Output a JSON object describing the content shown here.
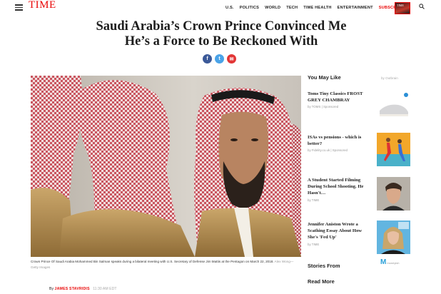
{
  "header": {
    "logo": "TIME",
    "nav": [
      "U.S.",
      "POLITICS",
      "WORLD",
      "TECH",
      "TIME HEALTH",
      "ENTERTAINMENT"
    ],
    "subscribe": "SUBSCRIBE",
    "cover_text": "TIME"
  },
  "article": {
    "headline_line1": "Saudi Arabia’s Crown Prince Convinced Me",
    "headline_line2": "He’s a Force to Be Reckoned With",
    "share": {
      "facebook": "f",
      "twitter": "t",
      "email": "✉"
    },
    "caption": "Crown Prince Of Saudi Arabia Mohammed Bin Salman speaks during a bilateral meeting with U.S. Secretary of Defense Jim Mattis at the Pentagon on March 22, 2018.",
    "credit": "Alex Wong—Getty Images",
    "byline_prefix": "By",
    "author": "JAMES STAVRIDIS",
    "time": "11:30 AM EDT"
  },
  "sidebar": {
    "title": "You May Like",
    "outbrain": "by Outbrain",
    "promos": [
      {
        "title": "Toms Tiny Classics FROST GREY CHAMBRAY",
        "source": "by TOMS | Sponsored"
      },
      {
        "title": "ISAs vs pensions - which is better?",
        "source": "by Fidelity.co.uk | Sponsored"
      },
      {
        "title": "A Student Started Filming During School Shooting. He Hasn't…",
        "source": "by TIME"
      },
      {
        "title": "Jennifer Aniston Wrote a Scathing Essay About How She's 'Fed Up'",
        "source": "by TIME"
      }
    ],
    "stories": "Stories From",
    "stories_logo": "M",
    "stories_logo_sub": "moneyish",
    "read_more": "Read More"
  },
  "colors": {
    "brand_red": "#e90606",
    "facebook": "#3b5998",
    "twitter": "#4aa3e8",
    "email": "#e23636"
  }
}
